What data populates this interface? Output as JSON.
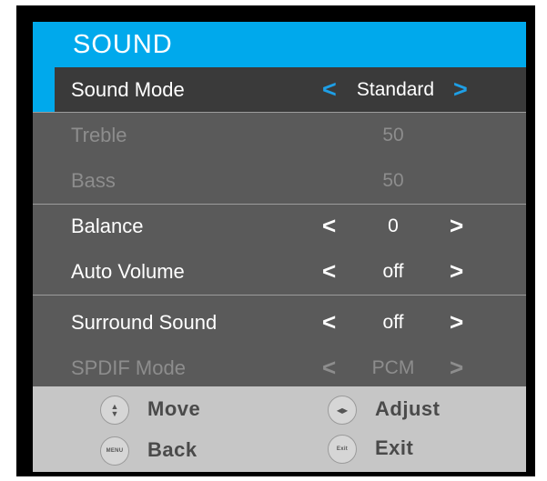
{
  "menu": {
    "title": "SOUND",
    "items": [
      {
        "label": "Sound Mode",
        "value": "Standard",
        "arrow_left": "<",
        "arrow_right": ">"
      },
      {
        "label": "Treble",
        "value": "50"
      },
      {
        "label": "Bass",
        "value": "50"
      },
      {
        "label": "Balance",
        "value": "0",
        "arrow_left": "<",
        "arrow_right": ">"
      },
      {
        "label": "Auto Volume",
        "value": "off",
        "arrow_left": "<",
        "arrow_right": ">"
      },
      {
        "label": "Surround Sound",
        "value": "off",
        "arrow_left": "<",
        "arrow_right": ">"
      },
      {
        "label": "SPDIF Mode",
        "value": "PCM",
        "arrow_left": "<",
        "arrow_right": ">"
      }
    ]
  },
  "footer": {
    "move": {
      "icon_glyph": "▲▼",
      "label": "Move"
    },
    "adjust": {
      "icon_glyph": "◀▶",
      "label": "Adjust"
    },
    "back": {
      "icon_text": "MENU",
      "label": "Back"
    },
    "exit": {
      "icon_text": "Exit",
      "label": "Exit"
    }
  },
  "colors": {
    "accent": "#00a9ec",
    "panel": "#5a5a5a",
    "selected_row": "#3a3a3a",
    "disabled_text": "#8d8d8d",
    "footer": "#c6c6c6"
  }
}
